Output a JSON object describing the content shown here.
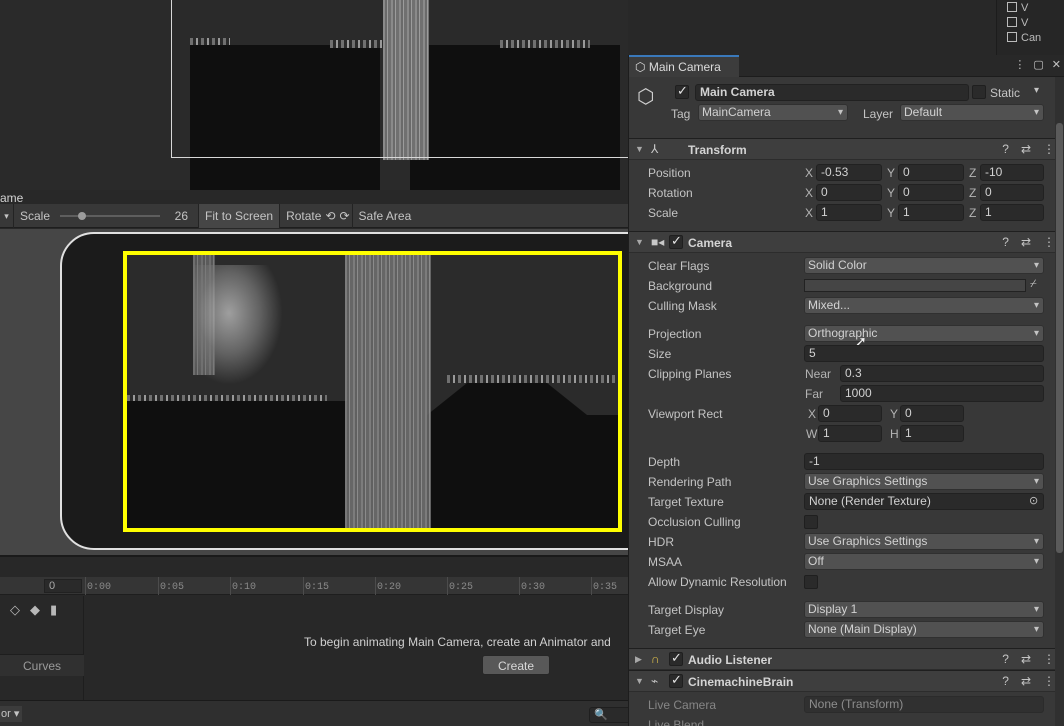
{
  "hierarchy": {
    "items": [
      "V",
      "V",
      "Can"
    ]
  },
  "game_view": {
    "tab_label": "ame",
    "scale_label": "Scale",
    "scale_value": "26",
    "scale_fraction": 0.2,
    "fit_to_screen": "Fit to Screen",
    "rotate": "Rotate",
    "safe_area": "Safe Area"
  },
  "animation": {
    "frame_value": "0",
    "ticks": [
      "0:00",
      "0:05",
      "0:10",
      "0:15",
      "0:20",
      "0:25",
      "0:30",
      "0:35"
    ],
    "message": "To begin animating Main Camera, create an Animator and",
    "create_button": "Create",
    "curves_tab": "Curves",
    "dropdown_label": "or",
    "search_placeholder": "🔍"
  },
  "inspector": {
    "tab_title": "Main Camera",
    "object": {
      "name": "Main Camera",
      "active": true,
      "static_label": "Static",
      "static_checked": false,
      "tag_label": "Tag",
      "tag_value": "MainCamera",
      "layer_label": "Layer",
      "layer_value": "Default"
    },
    "transform": {
      "title": "Transform",
      "position_label": "Position",
      "rotation_label": "Rotation",
      "scale_label": "Scale",
      "position": {
        "x": "-0.53",
        "y": "0",
        "z": "-10"
      },
      "rotation": {
        "x": "0",
        "y": "0",
        "z": "0"
      },
      "scale": {
        "x": "1",
        "y": "1",
        "z": "1"
      }
    },
    "camera": {
      "title": "Camera",
      "enabled": true,
      "clear_flags_label": "Clear Flags",
      "clear_flags": "Solid Color",
      "background_label": "Background",
      "background_color": "#454545",
      "culling_mask_label": "Culling Mask",
      "culling_mask": "Mixed...",
      "projection_label": "Projection",
      "projection": "Orthographic",
      "size_label": "Size",
      "size": "5",
      "clipping_label": "Clipping Planes",
      "near_label": "Near",
      "near": "0.3",
      "far_label": "Far",
      "far": "1000",
      "viewport_label": "Viewport Rect",
      "viewport": {
        "x": "0",
        "y": "0",
        "w": "1",
        "h": "1"
      },
      "depth_label": "Depth",
      "depth": "-1",
      "rendering_path_label": "Rendering Path",
      "rendering_path": "Use Graphics Settings",
      "target_texture_label": "Target Texture",
      "target_texture": "None (Render Texture)",
      "occlusion_label": "Occlusion Culling",
      "hdr_label": "HDR",
      "hdr": "Use Graphics Settings",
      "msaa_label": "MSAA",
      "msaa": "Off",
      "dynamic_res_label": "Allow Dynamic Resolution",
      "target_display_label": "Target Display",
      "target_display": "Display 1",
      "target_eye_label": "Target Eye",
      "target_eye": "None (Main Display)"
    },
    "audio_listener": {
      "title": "Audio Listener",
      "enabled": true
    },
    "cinemachine": {
      "title": "CinemachineBrain",
      "enabled": true,
      "live_camera_label": "Live Camera",
      "live_camera": "None (Transform)",
      "live_blend_label": "Live Blend"
    },
    "axis": {
      "x": "X",
      "y": "Y",
      "z": "Z",
      "w": "W",
      "h": "H"
    },
    "colors": {
      "accent": "#3a79bb",
      "safe_area": "#ffff00"
    }
  }
}
